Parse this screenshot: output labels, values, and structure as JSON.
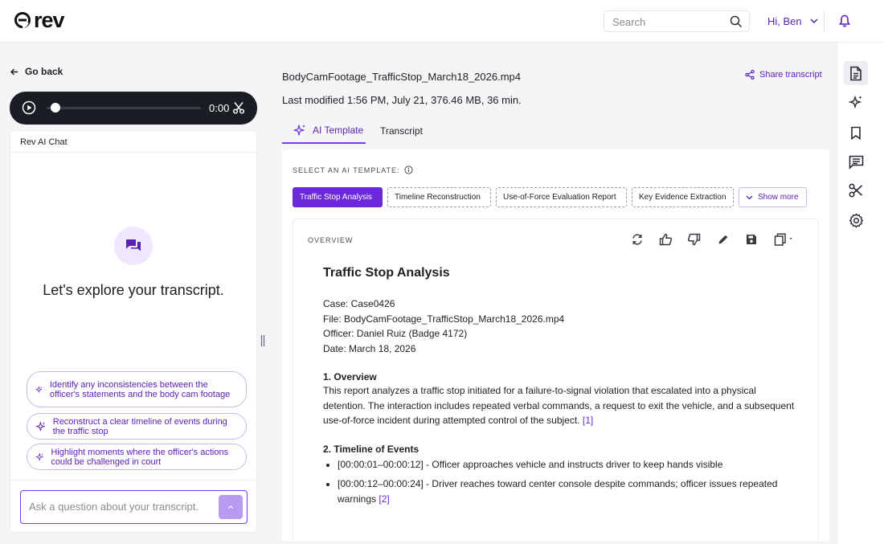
{
  "header": {
    "logo_text": "rev",
    "search_placeholder": "Search",
    "user_greeting": "Hi, Ben"
  },
  "player": {
    "go_back": "Go back",
    "time": "0:00",
    "progress": 0
  },
  "chat": {
    "title": "Rev AI Chat",
    "hero": "Let's explore your transcript.",
    "suggestions": [
      "Identify any inconsistencies between the officer's statements and the body cam footage",
      "Reconstruct a clear timeline of events during the traffic stop",
      "Highlight moments where the officer's actions could be challenged in court"
    ],
    "input_placeholder": "Ask a question about your transcript..."
  },
  "file": {
    "name": "BodyCamFootage_TrafficStop_March18_2026.mp4",
    "meta": "Last modified 1:56 PM, July 21, 376.46 MB, 36 min.",
    "share": "Share transcript"
  },
  "tabs": [
    "AI Template",
    "Transcript"
  ],
  "templates": {
    "label": "SELECT AN AI TEMPLATE:",
    "chips": [
      "Traffic Stop Analysis",
      "Timeline Reconstruction",
      "Use-of-Force Evaluation Report",
      "Key Evidence Extraction"
    ],
    "show_more": "Show more"
  },
  "report": {
    "section_label": "OVERVIEW",
    "title": "Traffic Stop Analysis",
    "case": "Case: Case0426",
    "file": "File: BodyCamFootage_TrafficStop_March18_2026.mp4",
    "officer": "Officer: Daniel Ruiz (Badge 4172)",
    "date": "Date: March 18, 2026",
    "h1": "1. Overview",
    "p1": "This report analyzes a traffic stop initiated for a failure-to-signal violation that escalated into a physical detention. The interaction includes repeated verbal commands, a request to exit the vehicle, and a subsequent use-of-force incident during attempted control of the subject.",
    "p1_ref": "[1]",
    "h2": "2. Timeline of Events",
    "events": [
      {
        "text": "[00:00:01–00:00:12] - Officer approaches vehicle and instructs driver to keep hands visible",
        "ref": ""
      },
      {
        "text": "[00:00:12–00:00:24] - Driver reaches toward center console despite commands; officer issues repeated warnings",
        "ref": "[2]"
      }
    ]
  },
  "colors": {
    "accent": "#6d28d9",
    "accent_text": "#5b21b6",
    "player_bg": "#1b1d24"
  },
  "sidebar_icons": [
    "document-icon",
    "sparkle-icon",
    "bookmark-icon",
    "comment-icon",
    "scissors-icon",
    "gear-icon"
  ]
}
